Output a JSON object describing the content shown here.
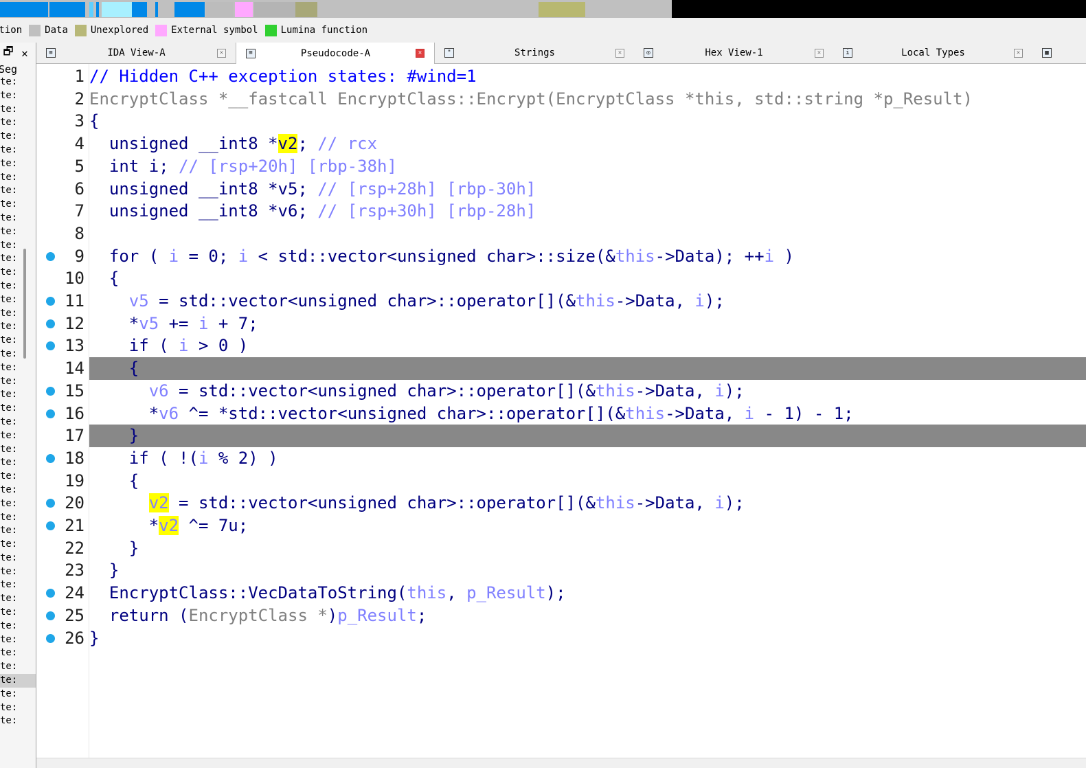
{
  "nav_band": {
    "segments": [
      {
        "color": "#0088e8"
      },
      {
        "color": "#5fd0ff"
      },
      {
        "color": "#a8f0ff"
      },
      {
        "color": "#ffa8ff"
      },
      {
        "color": "#a8a878"
      },
      {
        "color": "#b8b870"
      },
      {
        "color": "#000000"
      }
    ]
  },
  "legend": {
    "items": [
      {
        "label": "ction",
        "color": ""
      },
      {
        "label": "Data",
        "color": "#c0c0c0"
      },
      {
        "label": "Unexplored",
        "color": "#b8b878"
      },
      {
        "label": "External symbol",
        "color": "#ffa8ff"
      },
      {
        "label": "Lumina function",
        "color": "#30d030"
      }
    ]
  },
  "left_panel": {
    "header_restore": "🗗",
    "header_close": "✕",
    "column_header": "Seg",
    "row_text": "te:"
  },
  "tabs": [
    {
      "label": "IDA View-A",
      "active": false,
      "icon": "document-icon"
    },
    {
      "label": "Pseudocode-A",
      "active": true,
      "icon": "document-icon"
    },
    {
      "label": "Strings",
      "active": false,
      "icon": "strings-icon"
    },
    {
      "label": "Hex View-1",
      "active": false,
      "icon": "hex-icon"
    },
    {
      "label": "Local Types",
      "active": false,
      "icon": "info-icon"
    },
    {
      "label": "",
      "active": false,
      "icon": "table-icon"
    }
  ],
  "code": {
    "lines": [
      {
        "n": "1",
        "bp": false,
        "tokens": [
          [
            "com",
            "// Hidden C++ exception states: #wind=1"
          ]
        ]
      },
      {
        "n": "2",
        "bp": false,
        "tokens": [
          [
            "gray",
            "EncryptClass *__fastcall EncryptClass::Encrypt(EncryptClass *this, std::string *p_Result)"
          ]
        ]
      },
      {
        "n": "3",
        "bp": false,
        "tokens": [
          [
            "txt",
            "{"
          ]
        ]
      },
      {
        "n": "4",
        "bp": false,
        "tokens": [
          [
            "txt",
            "  unsigned __int8 *"
          ],
          [
            "hl",
            "v2"
          ],
          [
            "txt",
            "; "
          ],
          [
            "var",
            "// rcx"
          ]
        ]
      },
      {
        "n": "5",
        "bp": false,
        "tokens": [
          [
            "txt",
            "  int i; "
          ],
          [
            "var",
            "// [rsp+20h] [rbp-38h]"
          ]
        ]
      },
      {
        "n": "6",
        "bp": false,
        "tokens": [
          [
            "txt",
            "  unsigned __int8 *v5; "
          ],
          [
            "var",
            "// [rsp+28h] [rbp-30h]"
          ]
        ]
      },
      {
        "n": "7",
        "bp": false,
        "tokens": [
          [
            "txt",
            "  unsigned __int8 *v6; "
          ],
          [
            "var",
            "// [rsp+30h] [rbp-28h]"
          ]
        ]
      },
      {
        "n": "8",
        "bp": false,
        "tokens": [
          [
            "txt",
            ""
          ]
        ]
      },
      {
        "n": "9",
        "bp": true,
        "tokens": [
          [
            "txt",
            "  for ( "
          ],
          [
            "var",
            "i"
          ],
          [
            "txt",
            " = 0; "
          ],
          [
            "var",
            "i"
          ],
          [
            "txt",
            " < std::vector<unsigned char>::size(&"
          ],
          [
            "var",
            "this"
          ],
          [
            "txt",
            "->Data); ++"
          ],
          [
            "var",
            "i"
          ],
          [
            "txt",
            " )"
          ]
        ]
      },
      {
        "n": "10",
        "bp": false,
        "tokens": [
          [
            "txt",
            "  {"
          ]
        ]
      },
      {
        "n": "11",
        "bp": true,
        "tokens": [
          [
            "txt",
            "    "
          ],
          [
            "var",
            "v5"
          ],
          [
            "txt",
            " = std::vector<unsigned char>::operator[](&"
          ],
          [
            "var",
            "this"
          ],
          [
            "txt",
            "->Data, "
          ],
          [
            "var",
            "i"
          ],
          [
            "txt",
            ");"
          ]
        ]
      },
      {
        "n": "12",
        "bp": true,
        "tokens": [
          [
            "txt",
            "    *"
          ],
          [
            "var",
            "v5"
          ],
          [
            "txt",
            " += "
          ],
          [
            "var",
            "i"
          ],
          [
            "txt",
            " + 7;"
          ]
        ]
      },
      {
        "n": "13",
        "bp": true,
        "tokens": [
          [
            "txt",
            "    if ( "
          ],
          [
            "var",
            "i"
          ],
          [
            "txt",
            " > 0 )"
          ]
        ]
      },
      {
        "n": "14",
        "bp": false,
        "hl": true,
        "tokens": [
          [
            "txt",
            "    {"
          ]
        ]
      },
      {
        "n": "15",
        "bp": true,
        "tokens": [
          [
            "txt",
            "      "
          ],
          [
            "var",
            "v6"
          ],
          [
            "txt",
            " = std::vector<unsigned char>::operator[](&"
          ],
          [
            "var",
            "this"
          ],
          [
            "txt",
            "->Data, "
          ],
          [
            "var",
            "i"
          ],
          [
            "txt",
            ");"
          ]
        ]
      },
      {
        "n": "16",
        "bp": true,
        "tokens": [
          [
            "txt",
            "      *"
          ],
          [
            "var",
            "v6"
          ],
          [
            "txt",
            " ^= *std::vector<unsigned char>::operator[](&"
          ],
          [
            "var",
            "this"
          ],
          [
            "txt",
            "->Data, "
          ],
          [
            "var",
            "i"
          ],
          [
            "txt",
            " - 1) - 1;"
          ]
        ]
      },
      {
        "n": "17",
        "bp": false,
        "hl": true,
        "tokens": [
          [
            "txt",
            "    }"
          ]
        ]
      },
      {
        "n": "18",
        "bp": true,
        "tokens": [
          [
            "txt",
            "    if ( !("
          ],
          [
            "var",
            "i"
          ],
          [
            "txt",
            " % 2) )"
          ]
        ]
      },
      {
        "n": "19",
        "bp": false,
        "tokens": [
          [
            "txt",
            "    {"
          ]
        ]
      },
      {
        "n": "20",
        "bp": true,
        "tokens": [
          [
            "txt",
            "      "
          ],
          [
            "hl2",
            "v2"
          ],
          [
            "txt",
            " = std::vector<unsigned char>::operator[](&"
          ],
          [
            "var",
            "this"
          ],
          [
            "txt",
            "->Data, "
          ],
          [
            "var",
            "i"
          ],
          [
            "txt",
            ");"
          ]
        ]
      },
      {
        "n": "21",
        "bp": true,
        "tokens": [
          [
            "txt",
            "      *"
          ],
          [
            "hl2",
            "v2"
          ],
          [
            "txt",
            " ^= 7u;"
          ]
        ]
      },
      {
        "n": "22",
        "bp": false,
        "tokens": [
          [
            "txt",
            "    }"
          ]
        ]
      },
      {
        "n": "23",
        "bp": false,
        "tokens": [
          [
            "txt",
            "  }"
          ]
        ]
      },
      {
        "n": "24",
        "bp": true,
        "tokens": [
          [
            "txt",
            "  EncryptClass::VecDataToString("
          ],
          [
            "var",
            "this"
          ],
          [
            "txt",
            ", "
          ],
          [
            "var",
            "p_Result"
          ],
          [
            "txt",
            ");"
          ]
        ]
      },
      {
        "n": "25",
        "bp": true,
        "tokens": [
          [
            "txt",
            "  return ("
          ],
          [
            "gray",
            "EncryptClass *"
          ],
          [
            "txt",
            ")"
          ],
          [
            "var",
            "p_Result"
          ],
          [
            "txt",
            ";"
          ]
        ]
      },
      {
        "n": "26",
        "bp": true,
        "tokens": [
          [
            "txt",
            "}"
          ]
        ]
      }
    ]
  }
}
